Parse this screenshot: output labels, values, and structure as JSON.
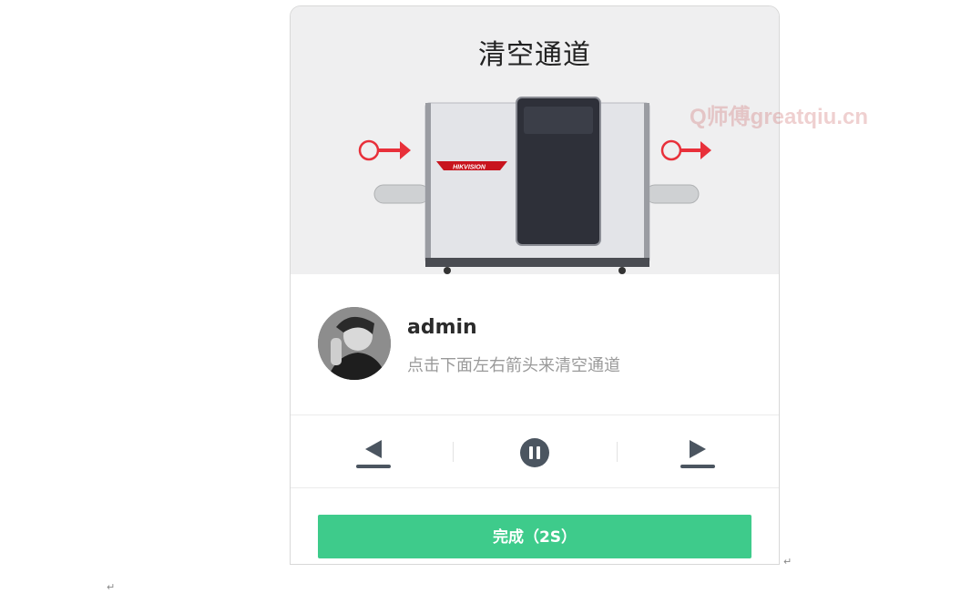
{
  "screen": {
    "title": "清空通道",
    "watermark": "Q师傅greatqiu.cn",
    "machine_brand": "HIKVISION"
  },
  "user": {
    "name": "admin",
    "hint": "点击下面左右箭头来清空通道"
  },
  "controls": {
    "left_icon": "conveyor-left-icon",
    "pause_icon": "pause-icon",
    "right_icon": "conveyor-right-icon"
  },
  "actions": {
    "done_label": "完成（2S）"
  },
  "colors": {
    "accent_green": "#3ecb8b",
    "arrow_red": "#e8303a",
    "icon_gray": "#4b5560"
  },
  "marks": {
    "para": "↵"
  }
}
